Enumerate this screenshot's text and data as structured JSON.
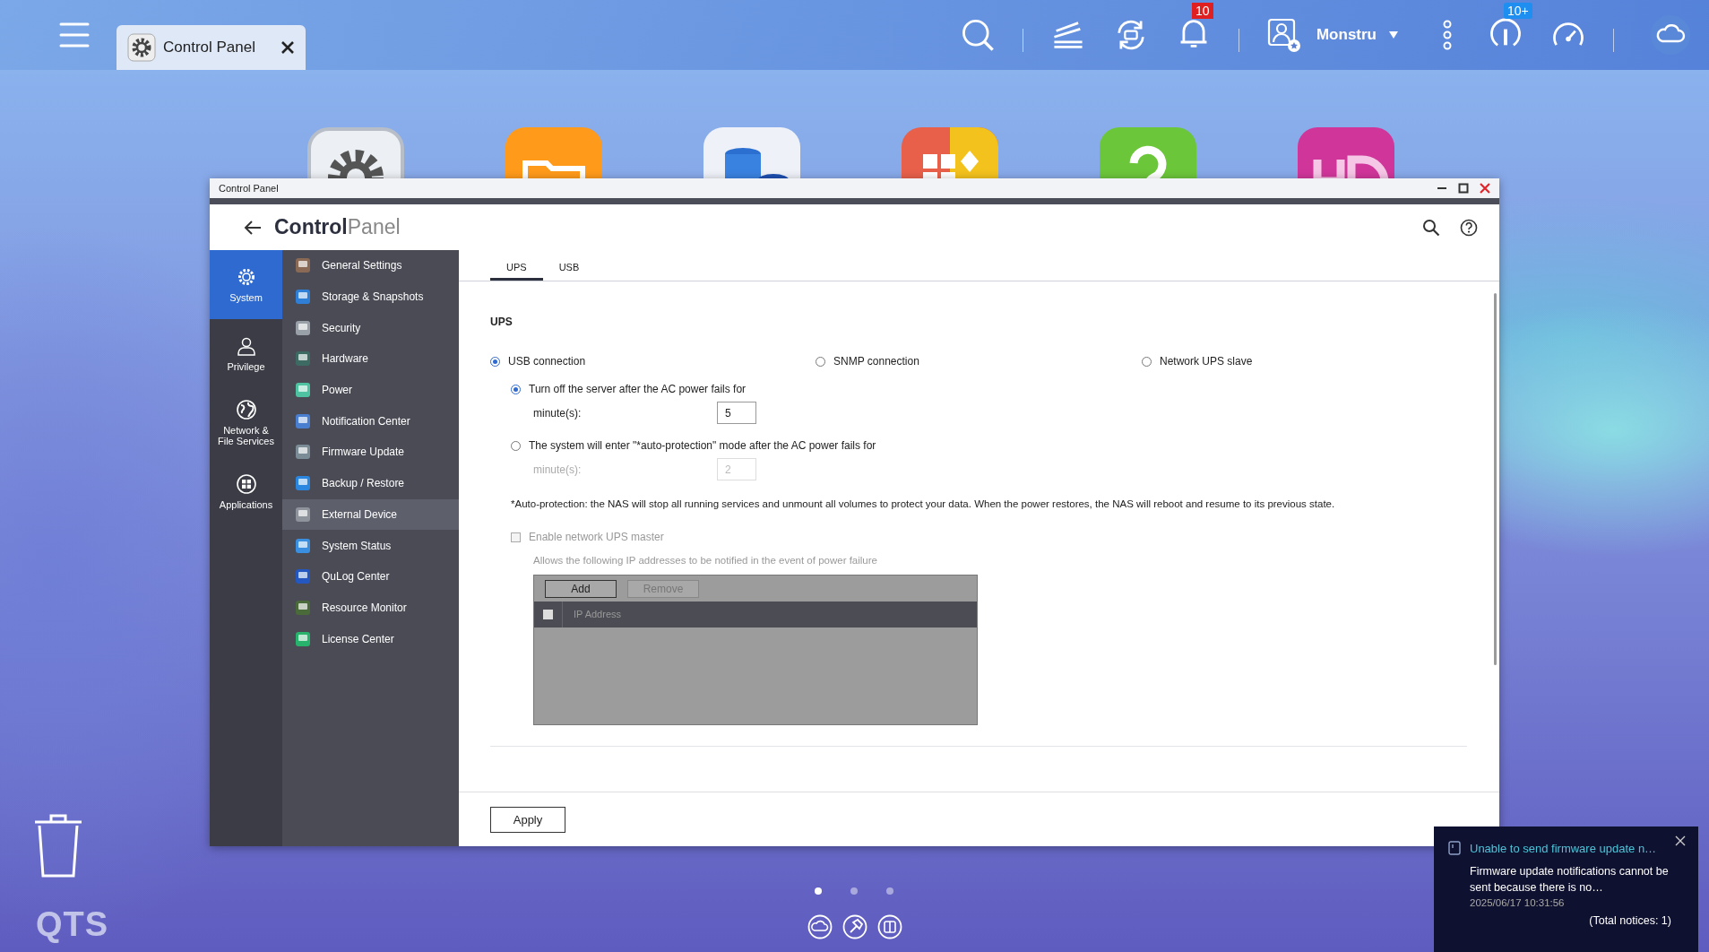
{
  "taskbar": {
    "tab_title": "Control Panel",
    "notification_count": "10",
    "user": "Monstru",
    "info_count": "10+"
  },
  "window": {
    "title": "Control Panel",
    "heading": "**Control**Panel"
  },
  "categories": [
    {
      "label": "System",
      "selected": true
    },
    {
      "label": "Privilege",
      "selected": false
    },
    {
      "label": "Network & File Services",
      "selected": false
    },
    {
      "label": "Applications",
      "selected": false
    }
  ],
  "menu": [
    {
      "label": "General Settings",
      "selected": false
    },
    {
      "label": "Storage & Snapshots",
      "selected": false
    },
    {
      "label": "Security",
      "selected": false
    },
    {
      "label": "Hardware",
      "selected": false
    },
    {
      "label": "Power",
      "selected": false
    },
    {
      "label": "Notification Center",
      "selected": false
    },
    {
      "label": "Firmware Update",
      "selected": false
    },
    {
      "label": "Backup / Restore",
      "selected": false
    },
    {
      "label": "External Device",
      "selected": true
    },
    {
      "label": "System Status",
      "selected": false
    },
    {
      "label": "QuLog Center",
      "selected": false
    },
    {
      "label": "Resource Monitor",
      "selected": false
    },
    {
      "label": "License Center",
      "selected": false
    }
  ],
  "tabs": [
    {
      "label": "UPS",
      "selected": true
    },
    {
      "label": "USB",
      "selected": false
    }
  ],
  "section_title": "UPS",
  "connection_options": [
    {
      "label": "USB connection",
      "selected": true
    },
    {
      "label": "SNMP connection",
      "selected": false
    },
    {
      "label": "Network UPS slave",
      "selected": false
    }
  ],
  "shutdown_options": [
    {
      "label": "Turn off the server after the AC power fails for",
      "selected": true,
      "minutes_label": "minute(s):",
      "minutes": "5",
      "disabled": false
    },
    {
      "label": "The system will enter \"*auto-protection\" mode after the AC power fails for",
      "selected": false,
      "minutes_label": "minute(s):",
      "minutes": "2",
      "disabled": true
    }
  ],
  "note": "*Auto-protection: the NAS will stop all running services and unmount all volumes to protect your data. When the power restores, the NAS will reboot and resume to its previous state.",
  "network_master": {
    "label": "Enable network UPS master",
    "checked": false,
    "disabled": true,
    "hint": "Allows the following IP addresses to be notified in the event of power failure",
    "buttons": [
      {
        "label": "Add",
        "disabled": false
      },
      {
        "label": "Remove",
        "disabled": true
      }
    ],
    "column": "IP Address",
    "header_checked": false
  },
  "apply": "Apply",
  "notification": {
    "title": "Unable to send firmware update n…",
    "body": "Firmware update notifications cannot be sent because there is no…",
    "time": "2025/06/17 10:31:56",
    "total": "(Total notices: 1)"
  },
  "desktop_label": "QTS",
  "pages": [
    {
      "selected": true
    },
    {
      "selected": false
    },
    {
      "selected": false
    }
  ]
}
